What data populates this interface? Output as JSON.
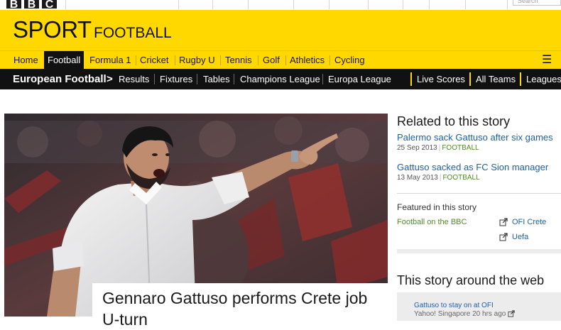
{
  "masthead": {
    "logo_letters": [
      "B",
      "B",
      "C"
    ],
    "search_placeholder": "Search"
  },
  "sport_banner": {
    "section": "SPORT",
    "subsection": "FOOTBALL"
  },
  "sport_nav": {
    "items": [
      "Home",
      "Football",
      "Formula 1",
      "Cricket",
      "Rugby U",
      "Tennis",
      "Golf",
      "Athletics",
      "Cycling"
    ],
    "active": "Football",
    "menu_icon": "menu-icon"
  },
  "sub_nav": {
    "section_title": "European Football",
    "chevron": ">",
    "items": [
      "Results",
      "Fixtures",
      "Tables",
      "Champions League",
      "Europa League"
    ],
    "right_items": [
      "Live Scores",
      "All Teams",
      "Leagues"
    ]
  },
  "article": {
    "headline": "Gennaro Gattuso performs Crete job U-turn"
  },
  "related": {
    "title": "Related to this story",
    "stories": [
      {
        "headline": "Palermo sack Gattuso after six games",
        "date": "25 Sep 2013",
        "category": "FOOTBALL"
      },
      {
        "headline": "Gattuso sacked as FC Sion manager",
        "date": "13 May 2013",
        "category": "FOOTBALL"
      }
    ]
  },
  "featured": {
    "title": "Featured in this story",
    "bbc_link": "Football on the BBC",
    "external_links": [
      "OFI Crete",
      "Uefa"
    ],
    "icon": "external-link-icon"
  },
  "around_web": {
    "title": "This story around the web",
    "story_title": "Gattuso to stay on at OFI",
    "story_source": "Yahoo! Singapore 20 hrs ago"
  },
  "colors": {
    "brand_yellow": "#ffd800",
    "nav_black": "#111111",
    "link_blue": "#1c5fa8",
    "tag_green": "#508a2a"
  }
}
